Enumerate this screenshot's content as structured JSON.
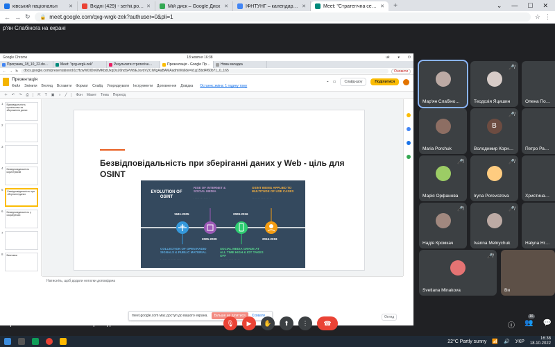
{
  "outer": {
    "tabs": [
      {
        "title": "ківський національн",
        "color": "#1a73e8"
      },
      {
        "title": "Вхідні (429) - serhii.pobihun@n…",
        "color": "#ea4335"
      },
      {
        "title": "Мій диск – Google Диск",
        "color": "#34a853"
      },
      {
        "title": "ІФНТУНГ – календар - вівторок",
        "color": "#4285f4"
      },
      {
        "title": "Meet: \"Стратегічна сесія ІФ…",
        "color": "#00897b"
      }
    ],
    "new_tab": "+",
    "url": "meet.google.com/qxg-wrgk-zek?authuser=0&pli=1"
  },
  "meet": {
    "presenter_label": "р'ян Слабінога на екрані",
    "meeting_title": "Стратегічна сесія ІФНТУНГ \"Впровадження інно…",
    "people_count": "16",
    "participants": [
      {
        "name": "Мар'ян Слабіно…",
        "kind": "photo",
        "active": true
      },
      {
        "name": "Теодозія Яцишин",
        "kind": "photo"
      },
      {
        "name": "Олена По…",
        "kind": "empty"
      },
      {
        "name": "Maria Porchuk",
        "kind": "photo"
      },
      {
        "name": "Володимир Корн…",
        "kind": "letter",
        "letter": "В"
      },
      {
        "name": "Петро Ра…",
        "kind": "empty"
      },
      {
        "name": "Марія Орфанова",
        "kind": "photo"
      },
      {
        "name": "Iryna Porevozova",
        "kind": "photo"
      },
      {
        "name": "Христина…",
        "kind": "empty"
      },
      {
        "name": "Надія Кромкач",
        "kind": "photo"
      },
      {
        "name": "Ivanna Melnychuk",
        "kind": "photo"
      },
      {
        "name": "Halyna Hr…",
        "kind": "empty"
      },
      {
        "name": "Svetlana Minakova",
        "kind": "photo"
      },
      {
        "name": "Ви",
        "kind": "self"
      }
    ]
  },
  "shared": {
    "window_title": "Google Chrome",
    "datetime": "18 жовтня 16:38",
    "lang": "uk",
    "tabs": [
      {
        "title": "Програма_18_10_22.do…",
        "color": "#4285f4"
      },
      {
        "title": "Meet: \"qxg-wrgk-zek\"",
        "color": "#00897b"
      },
      {
        "title": "Результати стратегічн…",
        "color": "#e91e63"
      },
      {
        "title": "Презентація - Google Пр…",
        "color": "#fbbc04"
      },
      {
        "title": "Нова вкладка",
        "color": "#9e9e9e"
      }
    ],
    "url": "docs.google.com/presentation/d/1cHzwWDlDn6IMKbdUxqDs26hdSPW9EJxvdVZCIWgAaBAMAadmit#slide=id.g15bd4f60b71_0_165",
    "update_label": "Оновити",
    "doc_title": "Презентація",
    "menu": [
      "Файл",
      "Змінити",
      "Вигляд",
      "Вставити",
      "Формат",
      "Слайд",
      "Упорядкувати",
      "Інструменти",
      "Доповнення",
      "Довідка"
    ],
    "last_edit": "Останнє зміна: 1 годину тому",
    "slideshow_label": "Слайд-шоу",
    "share_label": "Поділитися",
    "toolbar": [
      "Фон",
      "Макет",
      "Тема",
      "Перехід"
    ],
    "thumbnails": [
      {
        "num": "1",
        "text": "Відповідальність суспільства за збереження даних"
      },
      {
        "num": "2",
        "text": ""
      },
      {
        "num": "3",
        "text": ""
      },
      {
        "num": "4",
        "text": "Безвідповідальність користувачів"
      },
      {
        "num": "5",
        "text": "Безвідповідальність при зберіганні даних"
      },
      {
        "num": "6",
        "text": "Безвідповідальність у соцмережах"
      },
      {
        "num": "7",
        "text": ""
      },
      {
        "num": "8",
        "text": "Висновки"
      }
    ],
    "slide": {
      "title": "Безвідповідальність при зберіганні даних у Web - ціль для OSINT"
    },
    "infographic": {
      "title": "EVOLUTION OF OSINT",
      "y1": "1941-2005",
      "y2": "2005-2009",
      "y3": "2009-2016",
      "y4": "2016-2019",
      "cap1": "COLLECTION OF OPEN RADIO SIGNALS & PUBLIC MATERIAL",
      "cap2": "RISE OF INTERNET & SOCIAL MEDIA",
      "cap3": "SOCIAL MEDIA GRADE AT ALL TIME HIGH & IOT TAKES OFF",
      "cap4": "OSINT BEING APPLIED TO MULTITUDE OF USE CASES"
    },
    "notes_placeholder": "Натисніть, щоб додати нотатки доповідача",
    "share_notice": "meet.google.com має доступ до вашого екрана.",
    "stop_share": "Більше не ділитися",
    "hide": "Сховати",
    "tray_label": "Огляд"
  },
  "taskbar": {
    "weather": "22°C Partly sunny",
    "lang": "УКР",
    "time": "16:38",
    "date": "18.10.2022"
  }
}
